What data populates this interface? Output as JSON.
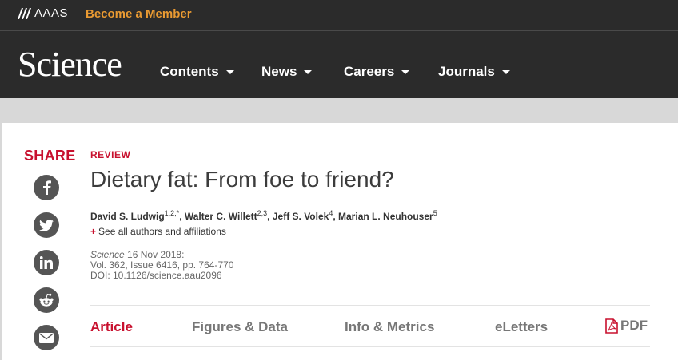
{
  "topbar": {
    "org": "AAAS",
    "member_link": "Become a Member"
  },
  "header": {
    "logo": "Science",
    "nav": [
      {
        "label": "Contents"
      },
      {
        "label": "News"
      },
      {
        "label": "Careers"
      },
      {
        "label": "Journals"
      }
    ]
  },
  "share": {
    "label": "SHARE",
    "icons": [
      "facebook-icon",
      "twitter-icon",
      "linkedin-icon",
      "reddit-icon",
      "email-icon"
    ]
  },
  "article": {
    "kicker": "REVIEW",
    "title": "Dietary fat: From foe to friend?",
    "authors": [
      {
        "name": "David S. Ludwig",
        "sup": "1,2,*"
      },
      {
        "name": "Walter C. Willett",
        "sup": "2,3"
      },
      {
        "name": "Jeff S. Volek",
        "sup": "4"
      },
      {
        "name": "Marian L. Neuhouser",
        "sup": "5"
      }
    ],
    "see_all": "See all authors and affiliations",
    "journal": "Science",
    "date": "16 Nov 2018:",
    "volume": "Vol. 362, Issue 6416, pp. 764-770",
    "doi": "DOI: 10.1126/science.aau2096"
  },
  "tabs": [
    {
      "label": "Article",
      "active": true
    },
    {
      "label": "Figures & Data",
      "active": false
    },
    {
      "label": "Info & Metrics",
      "active": false
    },
    {
      "label": "eLetters",
      "active": false
    }
  ],
  "pdf_label": "PDF",
  "colors": {
    "accent": "#c8102e",
    "member": "#e99a32",
    "header_bg": "#2b2b2b"
  }
}
